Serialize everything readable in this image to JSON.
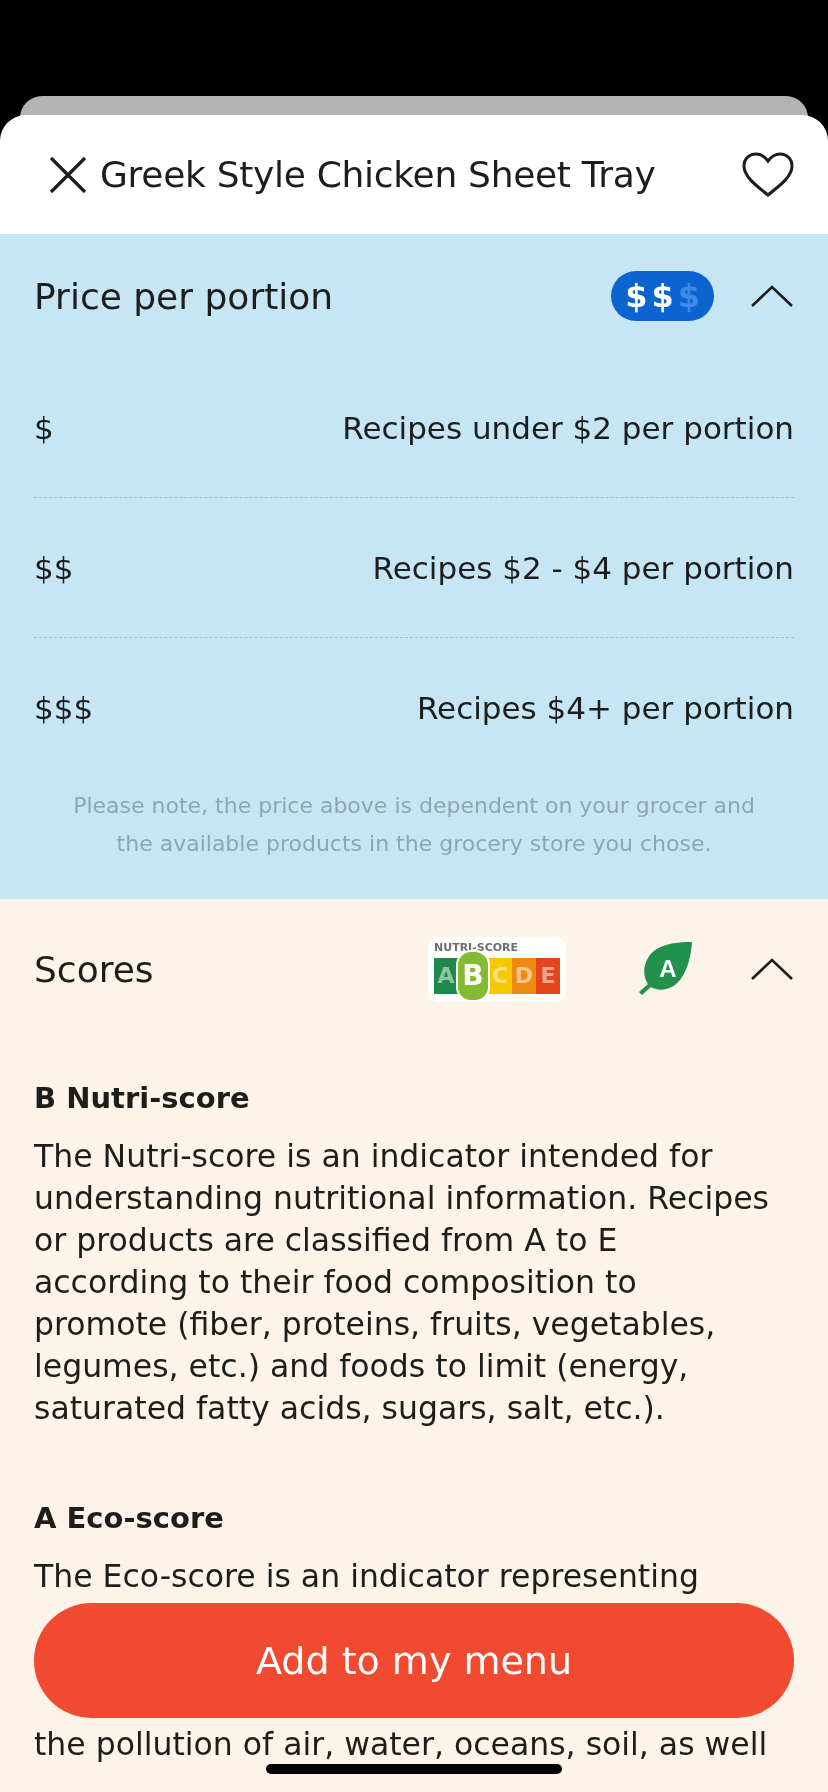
{
  "header": {
    "title": "Greek Style Chicken Sheet Tray",
    "favorite": false
  },
  "price": {
    "heading": "Price per portion",
    "expanded": true,
    "badge": [
      {
        "symbol": "$",
        "on": true
      },
      {
        "symbol": "$",
        "on": true
      },
      {
        "symbol": "$",
        "on": false
      }
    ],
    "rows": [
      {
        "symbol": "$",
        "description": "Recipes under $2 per portion"
      },
      {
        "symbol": "$$",
        "description": "Recipes $2 - $4 per portion"
      },
      {
        "symbol": "$$$",
        "description": "Recipes $4+ per portion"
      }
    ],
    "note": "Please note, the price above is dependent on your grocer and the available products in the grocery store you chose."
  },
  "scores": {
    "heading": "Scores",
    "expanded": true,
    "nutri_score": {
      "label": "NUTRI-SCORE",
      "grades": [
        {
          "letter": "A",
          "color": "#1e8a4a",
          "selected": false
        },
        {
          "letter": "B",
          "color": "#84bb33",
          "selected": true
        },
        {
          "letter": "C",
          "color": "#f6c800",
          "selected": false
        },
        {
          "letter": "D",
          "color": "#ee8a14",
          "selected": false
        },
        {
          "letter": "E",
          "color": "#e3461f",
          "selected": false
        }
      ]
    },
    "eco_score": {
      "grade": "A"
    },
    "sections": [
      {
        "title": "B Nutri-score",
        "lines": [
          {
            "text": "The Nutri-score is an indicator intended for"
          },
          {
            "text": "understanding nutritional information. Recipes"
          },
          {
            "text": "or products are classified from A to E"
          },
          {
            "text": "according to their food composition to"
          },
          {
            "text": "promote (fiber, proteins, fruits, vegetables,"
          },
          {
            "text": "legumes, etc.) and foods to limit (energy,"
          },
          {
            "text": "saturated fatty acids, sugars, salt, etc.)."
          }
        ]
      },
      {
        "title": "A Eco-score",
        "lines": [
          {
            "text": "The Eco-score is an indicator representing"
          },
          {
            "text": "the pollution of air, water, oceans, soil, as well",
            "covered_lines_before": true
          }
        ]
      }
    ]
  },
  "button": {
    "label": "Add to my menu"
  }
}
